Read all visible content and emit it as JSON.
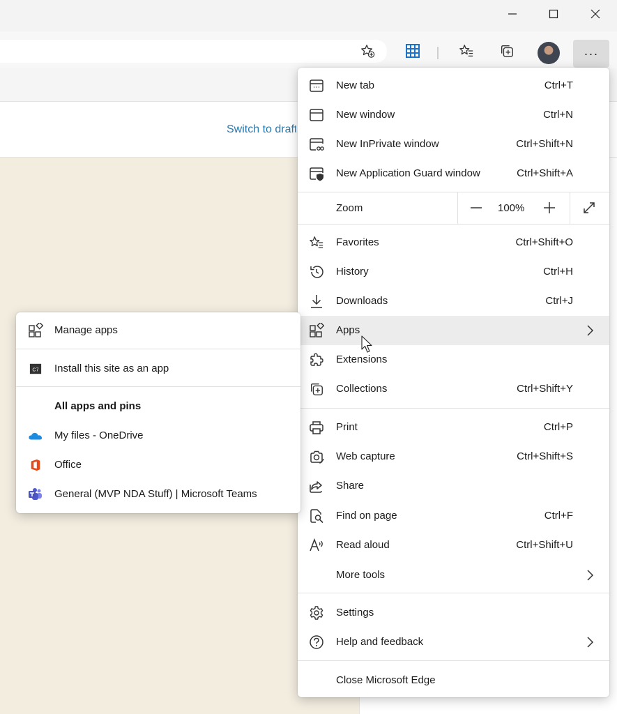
{
  "window": {
    "minimize_icon": "minimize-icon",
    "maximize_icon": "maximize-icon",
    "close_icon": "close-icon"
  },
  "toolbar": {
    "add_favorite_icon": "star-plus-icon",
    "apps_grid_icon": "apps-grid-icon",
    "favorites_icon": "favorites-icon",
    "collections_icon": "collections-icon",
    "more_label": "···"
  },
  "page": {
    "switch_link": "Switch to draft"
  },
  "main_menu": {
    "items": [
      {
        "label": "New tab",
        "shortcut": "Ctrl+T",
        "icon": "new-tab-icon"
      },
      {
        "label": "New window",
        "shortcut": "Ctrl+N",
        "icon": "new-window-icon"
      },
      {
        "label": "New InPrivate window",
        "shortcut": "Ctrl+Shift+N",
        "icon": "inprivate-icon"
      },
      {
        "label": "New Application Guard window",
        "shortcut": "Ctrl+Shift+A",
        "icon": "app-guard-icon"
      }
    ],
    "zoom": {
      "label": "Zoom",
      "value": "100%",
      "minus": "—",
      "plus": "+"
    },
    "items2": [
      {
        "label": "Favorites",
        "shortcut": "Ctrl+Shift+O",
        "icon": "favorites-icon"
      },
      {
        "label": "History",
        "shortcut": "Ctrl+H",
        "icon": "history-icon"
      },
      {
        "label": "Downloads",
        "shortcut": "Ctrl+J",
        "icon": "download-icon"
      },
      {
        "label": "Apps",
        "shortcut": "",
        "icon": "apps-icon"
      },
      {
        "label": "Extensions",
        "shortcut": "",
        "icon": "extensions-icon"
      },
      {
        "label": "Collections",
        "shortcut": "Ctrl+Shift+Y",
        "icon": "collections-icon"
      }
    ],
    "items3": [
      {
        "label": "Print",
        "shortcut": "Ctrl+P",
        "icon": "print-icon"
      },
      {
        "label": "Web capture",
        "shortcut": "Ctrl+Shift+S",
        "icon": "web-capture-icon"
      },
      {
        "label": "Share",
        "shortcut": "",
        "icon": "share-icon"
      },
      {
        "label": "Find on page",
        "shortcut": "Ctrl+F",
        "icon": "find-icon"
      },
      {
        "label": "Read aloud",
        "shortcut": "Ctrl+Shift+U",
        "icon": "read-aloud-icon"
      },
      {
        "label": "More tools",
        "shortcut": "",
        "icon": ""
      }
    ],
    "items4": [
      {
        "label": "Settings",
        "icon": "gear-icon"
      },
      {
        "label": "Help and feedback",
        "icon": "help-icon"
      }
    ],
    "close_label": "Close Microsoft Edge"
  },
  "apps_menu": {
    "manage": "Manage apps",
    "install": "Install this site as an app",
    "header": "All apps and pins",
    "apps": [
      {
        "label": "My files - OneDrive",
        "icon": "onedrive-icon"
      },
      {
        "label": "Office",
        "icon": "office-icon"
      },
      {
        "label": "General (MVP NDA Stuff) | Microsoft Teams",
        "icon": "teams-icon"
      }
    ]
  },
  "colors": {
    "page_background": "#f3ede0",
    "menu_hover": "#ececec",
    "link": "#2a7ab0",
    "apps_grid": "#1a73c9"
  }
}
